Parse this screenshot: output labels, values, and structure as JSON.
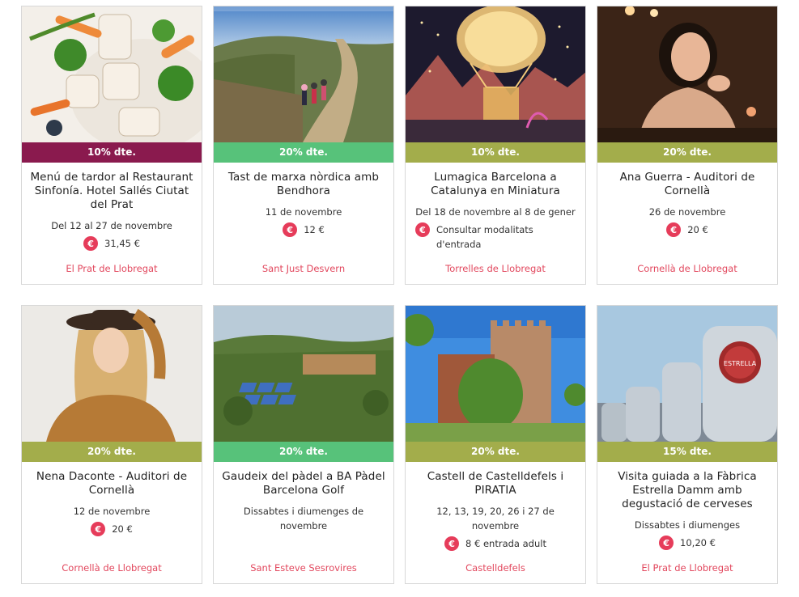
{
  "colors": {
    "badge_maroon": "#8a1a4e",
    "badge_green": "#57c27a",
    "badge_olive": "#a3ad4b",
    "euro_red": "#e63c5a",
    "location_red": "#e2485e"
  },
  "cards": [
    {
      "badge": "10% dte.",
      "title": "Menú de tardor al Restaurant Sinfonía. Hotel Sallés Ciutat del Prat",
      "date": "Del 12 al 27 de novembre",
      "price": "31,45 €",
      "location": "El Prat de Llobregat",
      "image": "food-plate-image"
    },
    {
      "badge": "20% dte.",
      "title": "Tast de marxa nòrdica amb Bendhora",
      "date": "11 de novembre",
      "price": "12 €",
      "location": "Sant Just Desvern",
      "image": "hiking-trail-image"
    },
    {
      "badge": "10% dte.",
      "title": "Lumagica Barcelona a Catalunya en Miniatura",
      "date": "Del 18 de novembre al 8 de gener",
      "price": "Consultar modalitats d'entrada",
      "location": "Torrelles de Llobregat",
      "image": "light-balloon-image"
    },
    {
      "badge": "20% dte.",
      "title": "Ana Guerra - Auditori de Cornellà",
      "date": "26 de novembre",
      "price": "20 €",
      "location": "Cornellà de Llobregat",
      "image": "singer-portrait-image"
    },
    {
      "badge": "20% dte.",
      "title": "Nena Daconte - Auditori de Cornellà",
      "date": "12 de novembre",
      "price": "20 €",
      "location": "Cornellà de Llobregat",
      "image": "singer-hat-image"
    },
    {
      "badge": "20% dte.",
      "title": "Gaudeix del pàdel a BA Pàdel Barcelona Golf",
      "date": "Dissabtes i diumenges de novembre",
      "price": "",
      "location": "Sant Esteve Sesrovires",
      "image": "padel-courts-image"
    },
    {
      "badge": "20% dte.",
      "title": "Castell de Castelldefels i PIRATIA",
      "date": "12, 13, 19, 20, 26 i 27 de novembre",
      "price": "8 € entrada adult",
      "location": "Castelldefels",
      "image": "castle-image"
    },
    {
      "badge": "15% dte.",
      "title": "Visita guiada a la Fàbrica Estrella Damm amb degustació de cerveses",
      "date": "Dissabtes i diumenges",
      "price": "10,20 €",
      "location": "El Prat de Llobregat",
      "image": "brewery-tanks-image"
    }
  ],
  "euro_symbol": "€",
  "brand_label": "ESTRELLA"
}
